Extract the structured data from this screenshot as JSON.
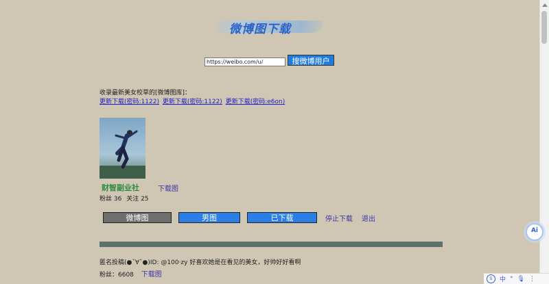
{
  "header": {
    "logo_text": "微博图下载"
  },
  "search": {
    "input_value": "https://weibo.com/u/",
    "button_label": "搜微博用户"
  },
  "collection": {
    "label": "收录最新美女校草的[微博图库]：",
    "links": [
      "更新下载(密码:1122)",
      "更新下载(密码:1122)",
      "更新下载(密码:e6on)"
    ]
  },
  "profile": {
    "name": "财智副业社",
    "download_label": "下载图",
    "fans_label": "粉丝 36",
    "follow_label": "关注 25"
  },
  "tabs": {
    "weibo": "微博图",
    "male": "男图",
    "downloaded": "已下载",
    "stop": "停止下载",
    "exit": "退出"
  },
  "post": {
    "text": "匿名投稿(●ˇ∀ˇ●)ID: @100·zy 好喜欢她是在看见的美女，好帅好好看啊",
    "fans_label": "粉丝：6608",
    "download_label": "下载图"
  },
  "floating": {
    "ai_label": "Ai"
  },
  "ime": {
    "lang": "中",
    "punct": "°",
    "mic": "🎙",
    "menu": "⋮"
  },
  "colors": {
    "background": "#cfc6b3",
    "accent_blue": "#2a7ee6",
    "gray_tab": "#6e6e6e",
    "name_green": "#2e8b40",
    "link_purple": "#3d36a8",
    "divider": "#5d706c"
  }
}
